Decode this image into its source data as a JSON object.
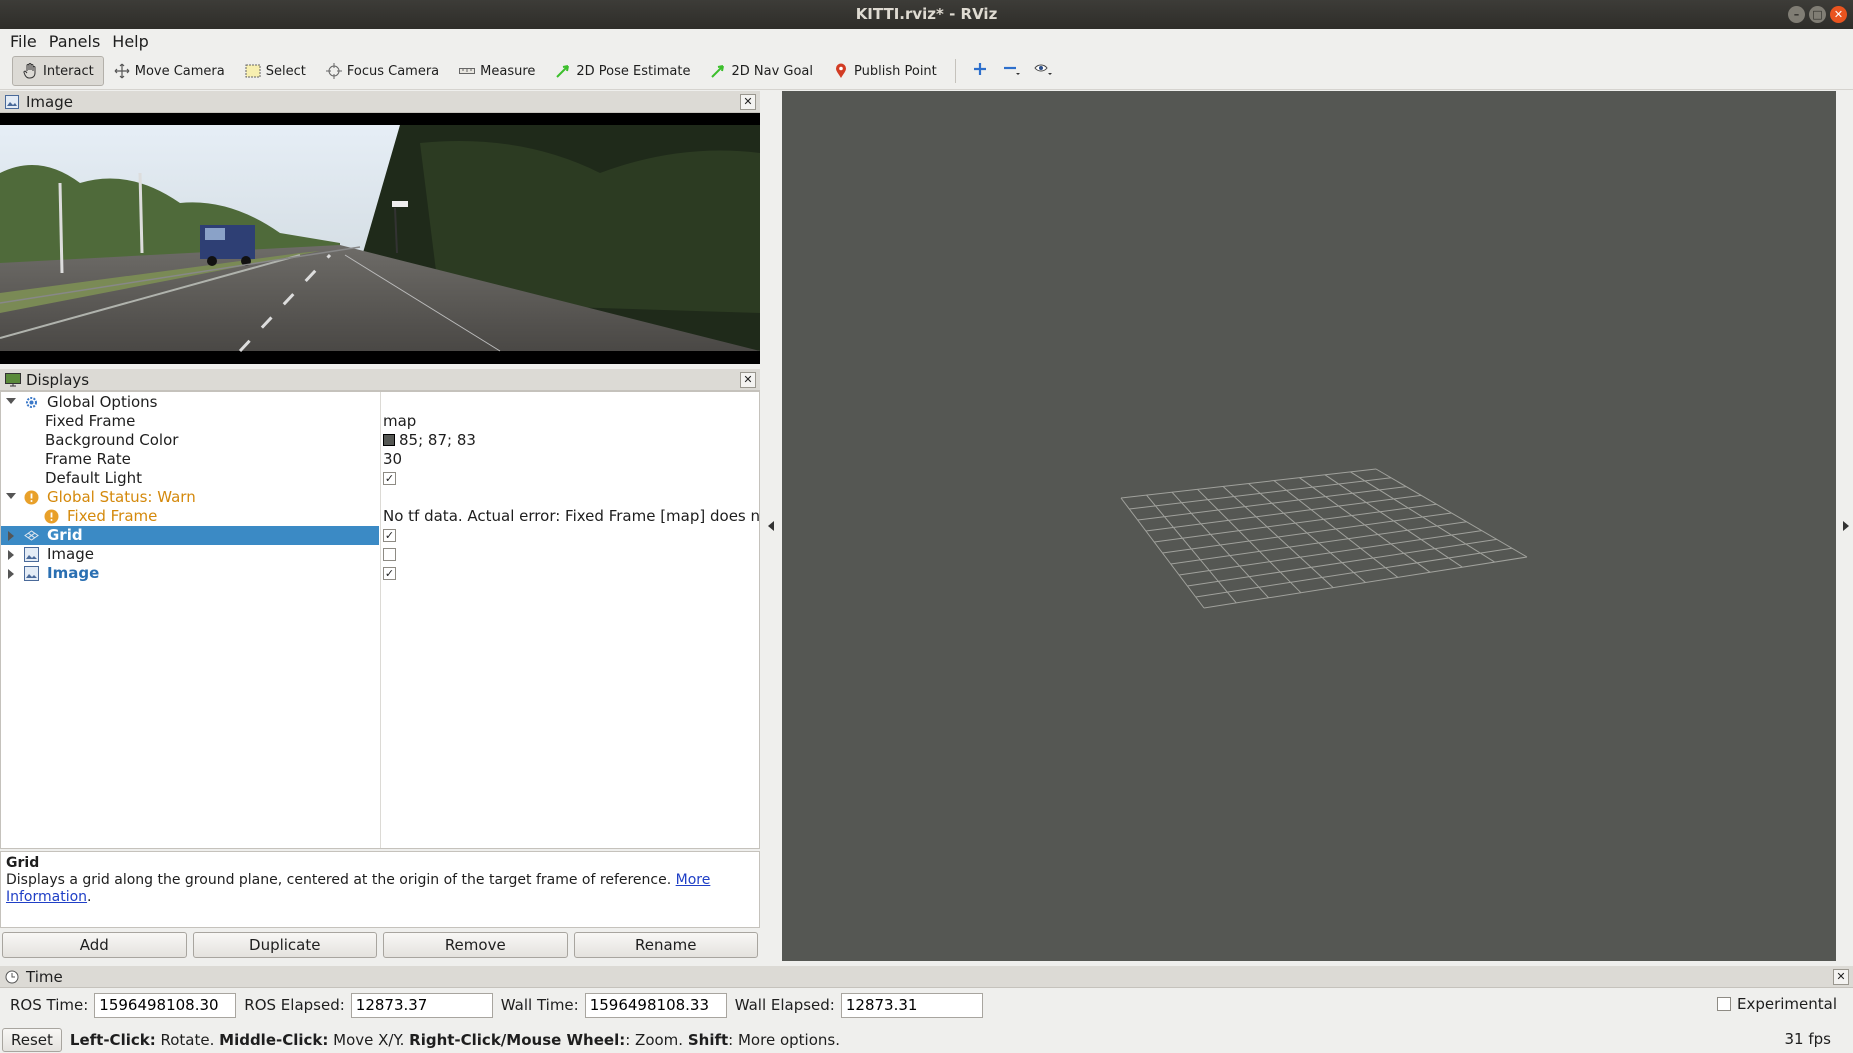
{
  "window": {
    "title": "KITTI.rviz* - RViz"
  },
  "menu": {
    "file": "File",
    "panels": "Panels",
    "help": "Help"
  },
  "toolbar": {
    "interact": "Interact",
    "move_camera": "Move Camera",
    "select": "Select",
    "focus_camera": "Focus Camera",
    "measure": "Measure",
    "pose_estimate": "2D Pose Estimate",
    "nav_goal": "2D Nav Goal",
    "publish_point": "Publish Point"
  },
  "image_panel": {
    "title": "Image"
  },
  "displays_panel": {
    "title": "Displays",
    "global_options": "Global Options",
    "fixed_frame_label": "Fixed Frame",
    "fixed_frame_value": "map",
    "background_color_label": "Background Color",
    "background_color_value": "85; 87; 83",
    "frame_rate_label": "Frame Rate",
    "frame_rate_value": "30",
    "default_light_label": "Default Light",
    "global_status_label": "Global Status: Warn",
    "status_fixed_frame_label": "Fixed Frame",
    "status_fixed_frame_value": "No tf data.  Actual error: Fixed Frame [map] does not…",
    "grid_label": "Grid",
    "image1_label": "Image",
    "image2_label": "Image"
  },
  "description": {
    "title": "Grid",
    "text": "Displays a grid along the ground plane, centered at the origin of the target frame of reference. ",
    "link": "More Information",
    "tail": "."
  },
  "buttons": {
    "add": "Add",
    "duplicate": "Duplicate",
    "remove": "Remove",
    "rename": "Rename"
  },
  "time_panel": {
    "title": "Time",
    "ros_time_label": "ROS Time:",
    "ros_time_value": "1596498108.30",
    "ros_elapsed_label": "ROS Elapsed:",
    "ros_elapsed_value": "12873.37",
    "wall_time_label": "Wall Time:",
    "wall_time_value": "1596498108.33",
    "wall_elapsed_label": "Wall Elapsed:",
    "wall_elapsed_value": "12873.31",
    "experimental_label": "Experimental"
  },
  "status_bar": {
    "reset": "Reset",
    "left_click": "Left-Click:",
    "left_click_desc": " Rotate. ",
    "middle_click": "Middle-Click:",
    "middle_click_desc": " Move X/Y. ",
    "right_click": "Right-Click/Mouse Wheel:",
    "right_click_desc": ": Zoom. ",
    "shift": "Shift",
    "shift_desc": ": More options.",
    "fps": "31 fps"
  },
  "colors": {
    "view_background": "#555753",
    "selection": "#3b8ac5",
    "warn": "#d4890c"
  }
}
